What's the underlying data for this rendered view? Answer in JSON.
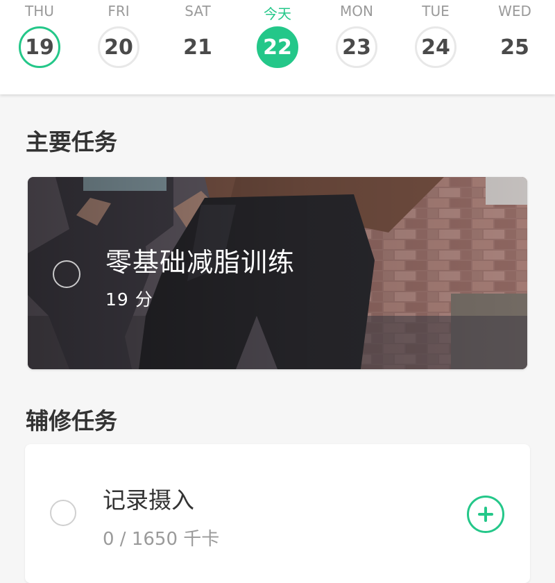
{
  "week": {
    "days": [
      {
        "label": "THU",
        "date": "19",
        "state": "done"
      },
      {
        "label": "FRI",
        "date": "20",
        "state": "ring"
      },
      {
        "label": "SAT",
        "date": "21",
        "state": "plain"
      },
      {
        "label": "今天",
        "date": "22",
        "state": "today"
      },
      {
        "label": "MON",
        "date": "23",
        "state": "ring"
      },
      {
        "label": "TUE",
        "date": "24",
        "state": "ring"
      },
      {
        "label": "WED",
        "date": "25",
        "state": "plain"
      }
    ]
  },
  "main_section": {
    "title": "主要任务",
    "task": {
      "name": "零基础减脂训练",
      "duration": "19 分",
      "image": "workout-photo",
      "check_icon": "circle-check-icon"
    }
  },
  "sub_section": {
    "title": "辅修任务",
    "task": {
      "name": "记录摄入",
      "progress": "0 / 1650 千卡",
      "add_icon": "plus-circle-icon",
      "check_icon": "circle-check-icon"
    }
  },
  "colors": {
    "accent": "#24c789",
    "text": "#333333",
    "muted": "#9a9a9a",
    "background": "#f6f6f6"
  }
}
